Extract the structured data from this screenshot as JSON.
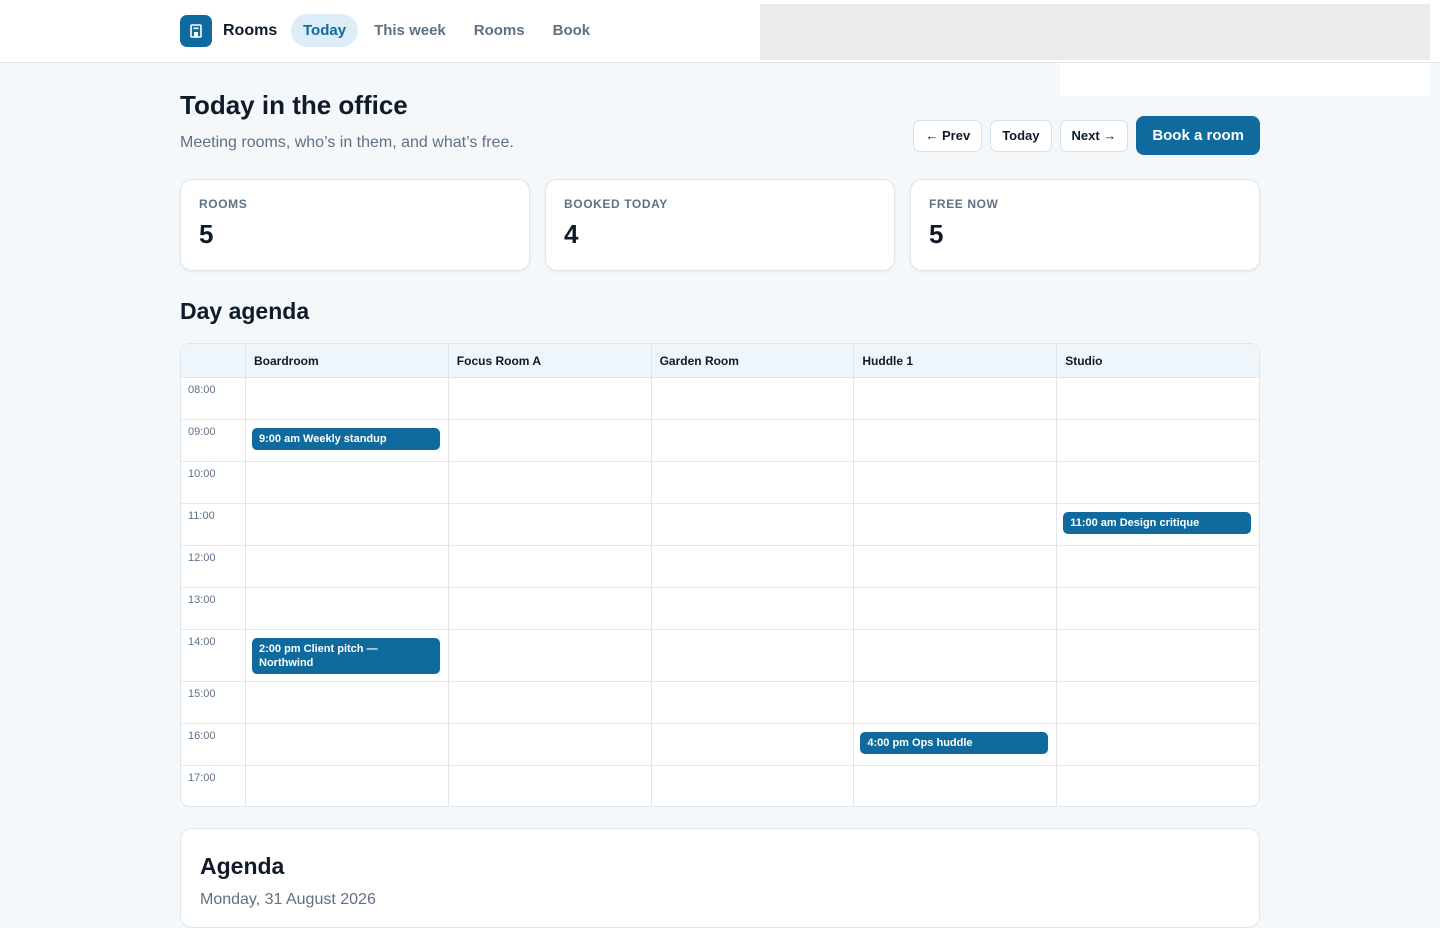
{
  "app": {
    "name": "Rooms",
    "logo_icon": "building-icon",
    "accent_color": "#0f6b9e"
  },
  "nav": [
    {
      "label": "Today",
      "active": true
    },
    {
      "label": "This week",
      "active": false
    },
    {
      "label": "Rooms",
      "active": false
    },
    {
      "label": "Book",
      "active": false
    }
  ],
  "page": {
    "title": "Today in the office",
    "subtitle": "Meeting rooms, who’s in them, and what’s free."
  },
  "toolbar": {
    "prev_label": "← Prev",
    "today_label": "Today",
    "next_label": "Next →",
    "book_label": "Book a room"
  },
  "stats": [
    {
      "label": "ROOMS",
      "value": "5"
    },
    {
      "label": "BOOKED TODAY",
      "value": "4"
    },
    {
      "label": "FREE NOW",
      "value": "5"
    }
  ],
  "day_agenda": {
    "title": "Day agenda",
    "rooms": [
      "Boardroom",
      "Focus Room A",
      "Garden Room",
      "Huddle 1",
      "Studio"
    ],
    "time_slots": [
      "08:00",
      "09:00",
      "10:00",
      "11:00",
      "12:00",
      "13:00",
      "14:00",
      "15:00",
      "16:00",
      "17:00"
    ],
    "events": [
      {
        "room_index": 0,
        "slot_index": 1,
        "label": "9:00 am Weekly standup"
      },
      {
        "room_index": 4,
        "slot_index": 3,
        "label": "11:00 am Design critique"
      },
      {
        "room_index": 0,
        "slot_index": 6,
        "label": "2:00 pm Client pitch — Northwind"
      },
      {
        "room_index": 3,
        "slot_index": 8,
        "label": "4:00 pm Ops huddle"
      }
    ]
  },
  "agenda": {
    "title": "Agenda",
    "date": "Monday, 31 August 2026"
  }
}
